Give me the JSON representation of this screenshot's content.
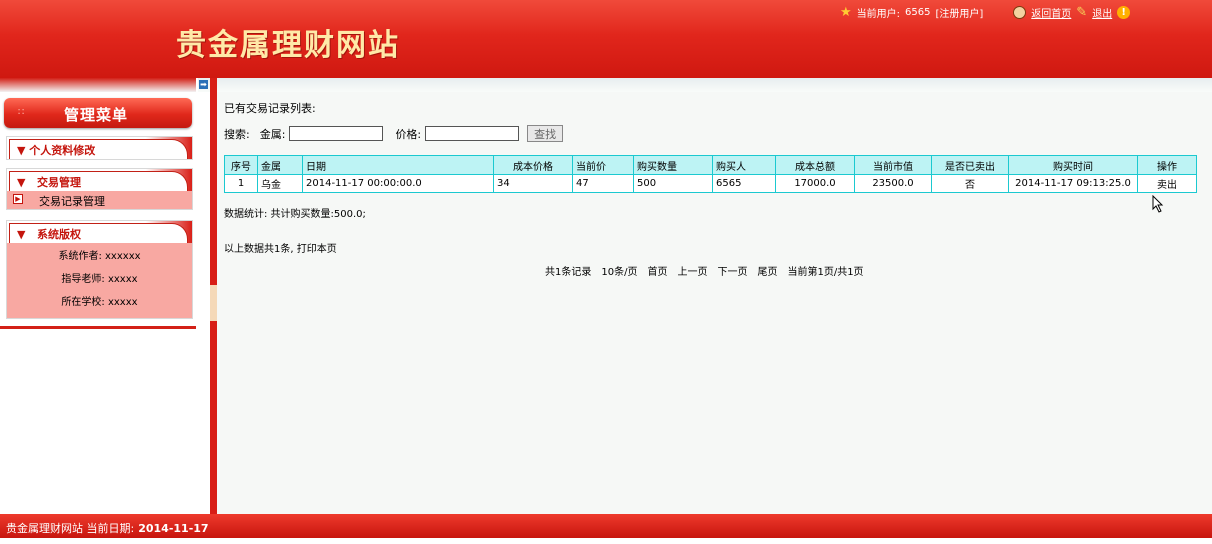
{
  "header": {
    "site_title": "贵金属理财网站",
    "current_user_label": "当前用户:",
    "current_user": "6565",
    "user_role": "[注册用户]",
    "home_link": "返回首页",
    "logout_link": "退出"
  },
  "sidebar": {
    "menu_title": "管理菜单",
    "sections": [
      {
        "title": "个人资料修改"
      },
      {
        "title": "交易管理",
        "items": [
          "交易记录管理"
        ]
      },
      {
        "title": "系统版权",
        "info": [
          "系统作者: xxxxxx",
          "指导老师: xxxxx",
          "所在学校: xxxxx"
        ]
      }
    ]
  },
  "main": {
    "list_title": "已有交易记录列表:",
    "search": {
      "label": "搜索:",
      "metal_label": "金属:",
      "metal_value": "",
      "price_label": "价格:",
      "price_value": "",
      "button": "查找"
    },
    "table": {
      "columns": [
        "序号",
        "金属",
        "日期",
        "成本价格",
        "当前价",
        "购买数量",
        "购买人",
        "成本总额",
        "当前市值",
        "是否已卖出",
        "购买时间",
        "操作"
      ],
      "rows": [
        [
          "1",
          "乌金",
          "2014-11-17 00:00:00.0",
          "34",
          "47",
          "500",
          "6565",
          "17000.0",
          "23500.0",
          "否",
          "2014-11-17 09:13:25.0",
          "卖出"
        ]
      ]
    },
    "stats": "数据统计: 共计购买数量:500.0;",
    "summary": "以上数据共1条, 打印本页",
    "pager": [
      "共1条记录",
      "10条/页",
      "首页",
      "上一页",
      "下一页",
      "尾页",
      "当前第1页/共1页"
    ]
  },
  "footer": {
    "text": "贵金属理财网站 当前日期:",
    "date": "2014-11-17"
  },
  "colors": {
    "brand_red": "#e1261c",
    "title_gold": "#ffe9a8",
    "table_header": "#bdf3f4",
    "table_border": "#1bc9d0",
    "sidebar_pink": "#f8a8a2"
  }
}
